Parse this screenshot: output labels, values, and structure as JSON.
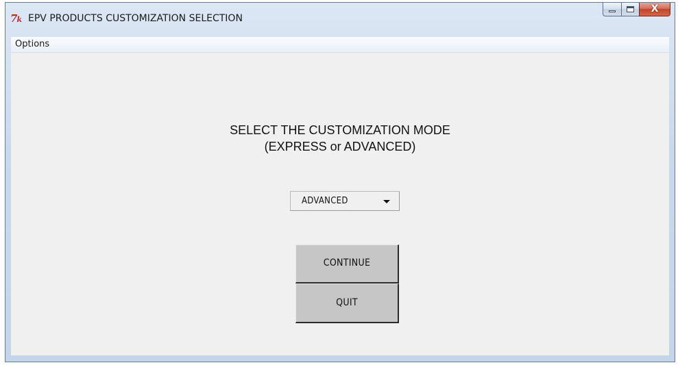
{
  "window": {
    "title": "EPV PRODUCTS CUSTOMIZATION SELECTION",
    "icon": "tk-feather-icon",
    "close_glyph": "X"
  },
  "menubar": {
    "items": [
      {
        "label": "Options"
      }
    ]
  },
  "main": {
    "prompt_line1": "SELECT THE CUSTOMIZATION MODE",
    "prompt_line2": "(EXPRESS or ADVANCED)",
    "mode_select": {
      "selected": "ADVANCED"
    },
    "continue_label": "CONTINUE",
    "quit_label": "QUIT"
  },
  "colors": {
    "client_bg": "#f0f0f0",
    "button_bg": "#c6c6c6",
    "close_button": "#c1442a",
    "icon_red": "#c3262b"
  }
}
